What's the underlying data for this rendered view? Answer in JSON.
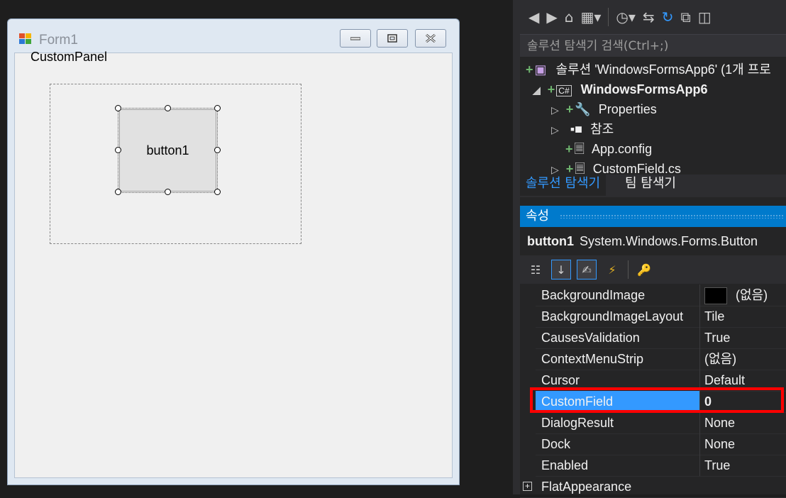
{
  "form": {
    "title": "Form1",
    "panel_label": "CustomPanel",
    "button_label": "button1"
  },
  "toolbar": {
    "items": [
      "back-icon",
      "forward-icon",
      "home-icon",
      "sync-icon",
      "history-icon",
      "switch-icon",
      "refresh-icon",
      "collapse-icon",
      "copy-icon"
    ]
  },
  "search": {
    "placeholder": "솔루션 탐색기 검색(Ctrl+;)"
  },
  "tree": {
    "solution": "솔루션 'WindowsFormsApp6' (1개 프로",
    "project": "WindowsFormsApp6",
    "properties": "Properties",
    "references": "참조",
    "appconfig": "App.config",
    "customfield": "CustomField.cs"
  },
  "tabs": {
    "solution_explorer": "솔루션 탐색기",
    "team_explorer": "팀 탐색기"
  },
  "properties": {
    "header": "속성",
    "object_name": "button1",
    "object_type": "System.Windows.Forms.Button",
    "rows": [
      {
        "name": "BackgroundImage",
        "value": "(없음)"
      },
      {
        "name": "BackgroundImageLayout",
        "value": "Tile"
      },
      {
        "name": "CausesValidation",
        "value": "True"
      },
      {
        "name": "ContextMenuStrip",
        "value": "(없음)"
      },
      {
        "name": "Cursor",
        "value": "Default"
      },
      {
        "name": "CustomField",
        "value": "0"
      },
      {
        "name": "DialogResult",
        "value": "None"
      },
      {
        "name": "Dock",
        "value": "None"
      },
      {
        "name": "Enabled",
        "value": "True"
      },
      {
        "name": "FlatAppearance",
        "value": ""
      }
    ]
  },
  "colors": {
    "accent": "#007acc",
    "selection": "#3399ff",
    "highlight_border": "#ff0000"
  }
}
